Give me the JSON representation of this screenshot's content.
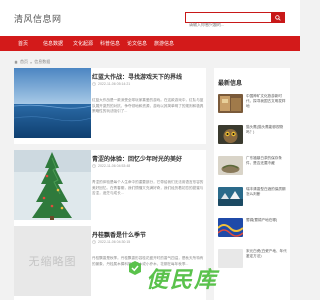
{
  "site": {
    "logo": "清风信息网"
  },
  "search": {
    "placeholder": "请输入你感兴趣的..."
  },
  "nav": {
    "items": [
      "首页",
      "信息数据",
      "文化起源",
      "科普信息",
      "论文信息",
      "旅游信息"
    ]
  },
  "breadcrumb": {
    "home": "首页",
    "separator": "»",
    "current": "信息数据"
  },
  "posts": [
    {
      "title": "红蓝大作战：寻找游戏天下的界线",
      "date": "2022-11-06 05:14:21",
      "excerpt": "红蓝大作战是一款深受全球玩家喜爱的游戏。在这款游戏中，红队与蓝队展开激烈的对抗，争夺领地和资源，游戏以其简单明了的规则和极具策略性的玩法吸引了..."
    },
    {
      "title": "青涩的体验：回忆少年时光的美好",
      "date": "2022-11-06 04:53:48",
      "excerpt": "青涩的体验是每个人生命中的重要部分，它带给我们无法用语言形容的美好回忆。在青春期，我们懵懂又充满好奇，我们经历着初恋的甜蜜与苦涩，迷茫与成长..."
    },
    {
      "title": "丹桂飘香是什么季节",
      "date": "2022-11-06 04:30:15",
      "excerpt": "丹桂飘香是秋季。丹桂飘香形容桂花盛开时的香气四溢，是秋天所特有的景象，丹桂属木樨科常绿灌木或小乔木，花期在每年秋季..."
    }
  ],
  "thumb_placeholder": "无缩略图",
  "sidebar": {
    "title": "最新信息",
    "items": [
      {
        "text": "中国神矿文化旅游新时代，探寻我国古文明发祥地"
      },
      {
        "text": "猫头鹰(猫头鹰能够视物吗？)"
      },
      {
        "text": "广东福鼎白茶的保存条件，是否还要冷藏"
      },
      {
        "text": "瑞丰清香型白酒的保质期怎么判断"
      },
      {
        "text": "蜀锦(蜀锦产地在哪)"
      },
      {
        "text": "宋元白瓷(白瓷产地、年代鉴定方法)"
      }
    ]
  },
  "watermark": {
    "text": "便民库"
  },
  "colors": {
    "brand_red": "#d31a1a",
    "watermark_green": "#5ac24c"
  }
}
